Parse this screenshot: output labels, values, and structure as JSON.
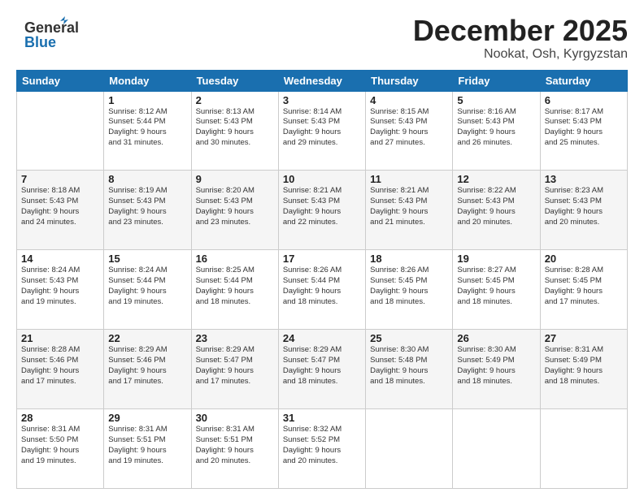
{
  "header": {
    "logo_general": "General",
    "logo_blue": "Blue",
    "month_title": "December 2025",
    "subtitle": "Nookat, Osh, Kyrgyzstan"
  },
  "days_of_week": [
    "Sunday",
    "Monday",
    "Tuesday",
    "Wednesday",
    "Thursday",
    "Friday",
    "Saturday"
  ],
  "weeks": [
    [
      {
        "day": "",
        "info": ""
      },
      {
        "day": "1",
        "info": "Sunrise: 8:12 AM\nSunset: 5:44 PM\nDaylight: 9 hours\nand 31 minutes."
      },
      {
        "day": "2",
        "info": "Sunrise: 8:13 AM\nSunset: 5:43 PM\nDaylight: 9 hours\nand 30 minutes."
      },
      {
        "day": "3",
        "info": "Sunrise: 8:14 AM\nSunset: 5:43 PM\nDaylight: 9 hours\nand 29 minutes."
      },
      {
        "day": "4",
        "info": "Sunrise: 8:15 AM\nSunset: 5:43 PM\nDaylight: 9 hours\nand 27 minutes."
      },
      {
        "day": "5",
        "info": "Sunrise: 8:16 AM\nSunset: 5:43 PM\nDaylight: 9 hours\nand 26 minutes."
      },
      {
        "day": "6",
        "info": "Sunrise: 8:17 AM\nSunset: 5:43 PM\nDaylight: 9 hours\nand 25 minutes."
      }
    ],
    [
      {
        "day": "7",
        "info": "Sunrise: 8:18 AM\nSunset: 5:43 PM\nDaylight: 9 hours\nand 24 minutes."
      },
      {
        "day": "8",
        "info": "Sunrise: 8:19 AM\nSunset: 5:43 PM\nDaylight: 9 hours\nand 23 minutes."
      },
      {
        "day": "9",
        "info": "Sunrise: 8:20 AM\nSunset: 5:43 PM\nDaylight: 9 hours\nand 23 minutes."
      },
      {
        "day": "10",
        "info": "Sunrise: 8:21 AM\nSunset: 5:43 PM\nDaylight: 9 hours\nand 22 minutes."
      },
      {
        "day": "11",
        "info": "Sunrise: 8:21 AM\nSunset: 5:43 PM\nDaylight: 9 hours\nand 21 minutes."
      },
      {
        "day": "12",
        "info": "Sunrise: 8:22 AM\nSunset: 5:43 PM\nDaylight: 9 hours\nand 20 minutes."
      },
      {
        "day": "13",
        "info": "Sunrise: 8:23 AM\nSunset: 5:43 PM\nDaylight: 9 hours\nand 20 minutes."
      }
    ],
    [
      {
        "day": "14",
        "info": "Sunrise: 8:24 AM\nSunset: 5:43 PM\nDaylight: 9 hours\nand 19 minutes."
      },
      {
        "day": "15",
        "info": "Sunrise: 8:24 AM\nSunset: 5:44 PM\nDaylight: 9 hours\nand 19 minutes."
      },
      {
        "day": "16",
        "info": "Sunrise: 8:25 AM\nSunset: 5:44 PM\nDaylight: 9 hours\nand 18 minutes."
      },
      {
        "day": "17",
        "info": "Sunrise: 8:26 AM\nSunset: 5:44 PM\nDaylight: 9 hours\nand 18 minutes."
      },
      {
        "day": "18",
        "info": "Sunrise: 8:26 AM\nSunset: 5:45 PM\nDaylight: 9 hours\nand 18 minutes."
      },
      {
        "day": "19",
        "info": "Sunrise: 8:27 AM\nSunset: 5:45 PM\nDaylight: 9 hours\nand 18 minutes."
      },
      {
        "day": "20",
        "info": "Sunrise: 8:28 AM\nSunset: 5:45 PM\nDaylight: 9 hours\nand 17 minutes."
      }
    ],
    [
      {
        "day": "21",
        "info": "Sunrise: 8:28 AM\nSunset: 5:46 PM\nDaylight: 9 hours\nand 17 minutes."
      },
      {
        "day": "22",
        "info": "Sunrise: 8:29 AM\nSunset: 5:46 PM\nDaylight: 9 hours\nand 17 minutes."
      },
      {
        "day": "23",
        "info": "Sunrise: 8:29 AM\nSunset: 5:47 PM\nDaylight: 9 hours\nand 17 minutes."
      },
      {
        "day": "24",
        "info": "Sunrise: 8:29 AM\nSunset: 5:47 PM\nDaylight: 9 hours\nand 18 minutes."
      },
      {
        "day": "25",
        "info": "Sunrise: 8:30 AM\nSunset: 5:48 PM\nDaylight: 9 hours\nand 18 minutes."
      },
      {
        "day": "26",
        "info": "Sunrise: 8:30 AM\nSunset: 5:49 PM\nDaylight: 9 hours\nand 18 minutes."
      },
      {
        "day": "27",
        "info": "Sunrise: 8:31 AM\nSunset: 5:49 PM\nDaylight: 9 hours\nand 18 minutes."
      }
    ],
    [
      {
        "day": "28",
        "info": "Sunrise: 8:31 AM\nSunset: 5:50 PM\nDaylight: 9 hours\nand 19 minutes."
      },
      {
        "day": "29",
        "info": "Sunrise: 8:31 AM\nSunset: 5:51 PM\nDaylight: 9 hours\nand 19 minutes."
      },
      {
        "day": "30",
        "info": "Sunrise: 8:31 AM\nSunset: 5:51 PM\nDaylight: 9 hours\nand 20 minutes."
      },
      {
        "day": "31",
        "info": "Sunrise: 8:32 AM\nSunset: 5:52 PM\nDaylight: 9 hours\nand 20 minutes."
      },
      {
        "day": "",
        "info": ""
      },
      {
        "day": "",
        "info": ""
      },
      {
        "day": "",
        "info": ""
      }
    ]
  ]
}
